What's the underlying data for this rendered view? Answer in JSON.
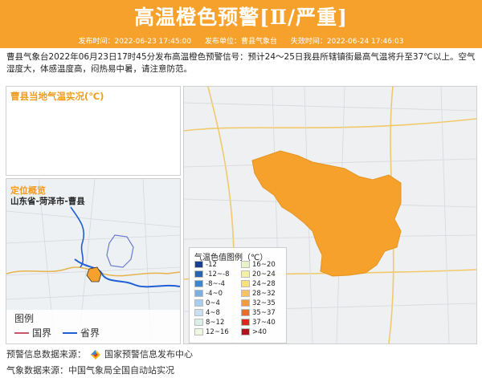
{
  "header": {
    "title": "高温橙色预警[Ⅱ/严重]",
    "publish_time": "发布时间：2022-06-23 17:45:00",
    "publisher": "发布单位：曹县气象台",
    "expire_time": "失效时间：2022-06-24 17:46:03"
  },
  "description": "曹县气象台2022年06月23日17时45分发布高温橙色预警信号：预计24～25日我县所辖镇街最高气温将升至37℃以上。空气湿度大，体感温度高，闷热易中暑，请注意防范。",
  "temp_panel": {
    "title": "曹县当地气温实况(℃)"
  },
  "location_panel": {
    "title": "定位概览",
    "location": "山东省-菏泽市-曹县",
    "legend_title": "图例",
    "legend_items": [
      {
        "label": "国界",
        "color": "#c9566a"
      },
      {
        "label": "省界",
        "color": "#1f5fd6"
      }
    ]
  },
  "big_map": {
    "legend_title": "气温色值图例（℃）",
    "legend_items": [
      {
        "label": "-12",
        "color": "#1b3f8f"
      },
      {
        "label": "16~20",
        "color": "#e7f2c6"
      },
      {
        "label": "-12~-8",
        "color": "#2a62b8"
      },
      {
        "label": "20~24",
        "color": "#f4f0a8"
      },
      {
        "label": "-8~-4",
        "color": "#3f86cf"
      },
      {
        "label": "24~28",
        "color": "#f8e07a"
      },
      {
        "label": "-4~0",
        "color": "#7bb0e2"
      },
      {
        "label": "28~32",
        "color": "#f7c35d"
      },
      {
        "label": "0~4",
        "color": "#a9cdee"
      },
      {
        "label": "32~35",
        "color": "#f29c3d"
      },
      {
        "label": "4~8",
        "color": "#c8e0f2"
      },
      {
        "label": "35~37",
        "color": "#ec6a2b"
      },
      {
        "label": "8~12",
        "color": "#dcefe7"
      },
      {
        "label": "37~40",
        "color": "#d9291e"
      },
      {
        "label": "12~16",
        "color": "#eef7df"
      },
      {
        "label": ">40",
        "color": "#b5101c"
      }
    ]
  },
  "footer": {
    "warning_source_label": "预警信息数据来源：",
    "warning_source": "国家预警信息发布中心",
    "weather_source": "气象数据来源：中国气象局全国自动站实况"
  },
  "colors": {
    "header": "#f7a12d",
    "region": "#f7a12d",
    "accent_title": "#f39b1b"
  }
}
